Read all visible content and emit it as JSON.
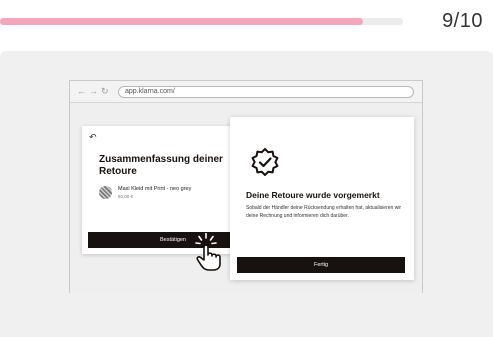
{
  "progress": {
    "fraction": 0.9,
    "counter": "9/10",
    "fill_color": "#f3a6bc"
  },
  "browser": {
    "url": "app.klarna.com/"
  },
  "summary_card": {
    "title": "Zusammenfassung deiner Retoure",
    "product_name": "Maxi Kleid mit Print - neo grey",
    "product_price": "60,00 €",
    "confirm_label": "Bestätigen"
  },
  "done_card": {
    "title": "Deine Retoure wurde vorgemerkt",
    "text": "Sobald der Händler deine Rücksendung erhalten hat, aktualisieren wir deine Rechnung und informieren dich darüber.",
    "button_label": "Fertig"
  },
  "colors": {
    "dark": "#17120f",
    "stage": "#f0f0f0"
  }
}
